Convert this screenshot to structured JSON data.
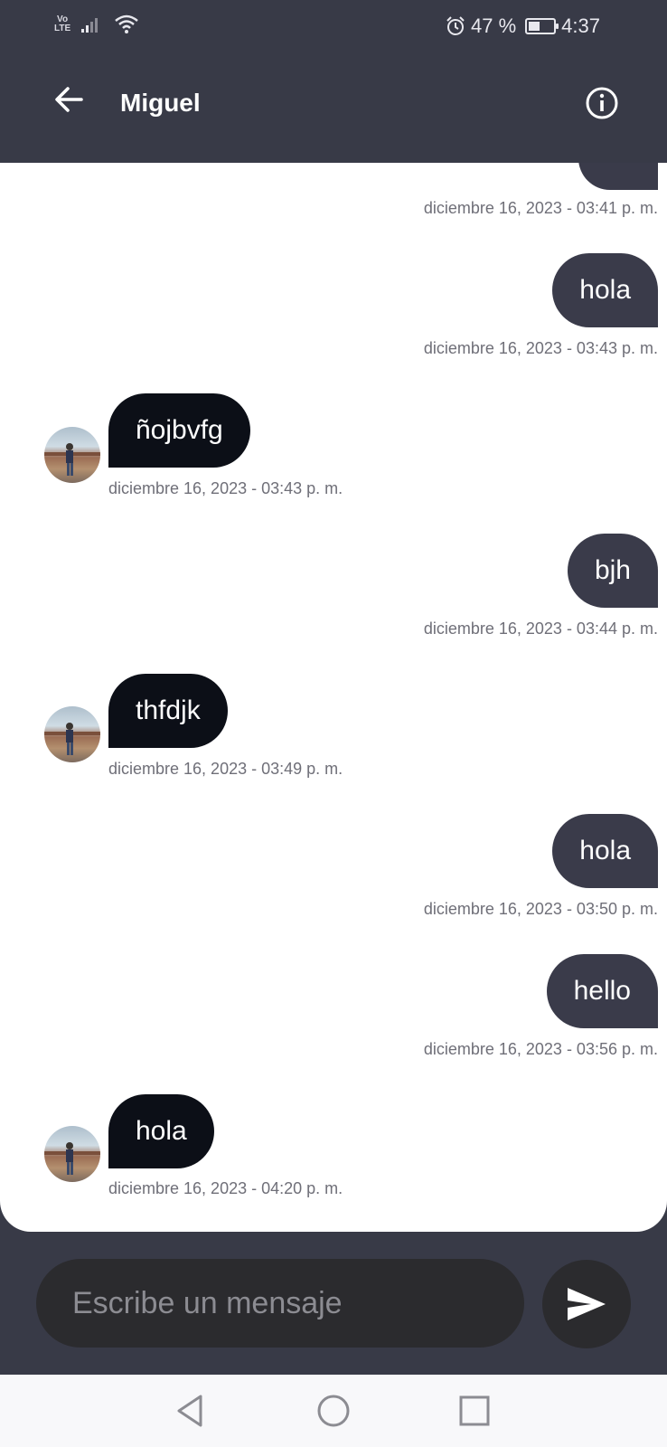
{
  "status_bar": {
    "network": "Vo LTE",
    "battery_text": "47 %",
    "battery_level": 0.47,
    "time": "4:37"
  },
  "header": {
    "title": "Miguel",
    "back_icon": "arrow-left-icon",
    "info_icon": "info-icon"
  },
  "messages": [
    {
      "direction": "out",
      "text": "",
      "time": "diciembre 16, 2023 - 03:41 p. m."
    },
    {
      "direction": "out",
      "text": "hola",
      "time": "diciembre 16, 2023 - 03:43 p. m."
    },
    {
      "direction": "in",
      "text": "ñojbvfg",
      "time": "diciembre 16, 2023 - 03:43 p. m."
    },
    {
      "direction": "out",
      "text": "bjh",
      "time": "diciembre 16, 2023 - 03:44 p. m."
    },
    {
      "direction": "in",
      "text": "thfdjk",
      "time": "diciembre 16, 2023 - 03:49 p. m."
    },
    {
      "direction": "out",
      "text": "hola",
      "time": "diciembre 16, 2023 - 03:50 p. m."
    },
    {
      "direction": "out",
      "text": "hello",
      "time": "diciembre 16, 2023 - 03:56 p. m."
    },
    {
      "direction": "in",
      "text": "hola",
      "time": "diciembre 16, 2023 - 04:20 p. m."
    }
  ],
  "composer": {
    "placeholder": "Escribe un mensaje",
    "value": "",
    "send_icon": "send-icon"
  },
  "colors": {
    "header_bg": "#383a47",
    "outgoing_bubble": "#3a3b4a",
    "incoming_bubble": "#0c0f17",
    "input_bg": "#2b2b2e",
    "timestamp": "#6f6f78"
  },
  "nav_bar": {
    "back_icon": "nav-back-icon",
    "home_icon": "nav-home-icon",
    "recents_icon": "nav-recents-icon"
  }
}
